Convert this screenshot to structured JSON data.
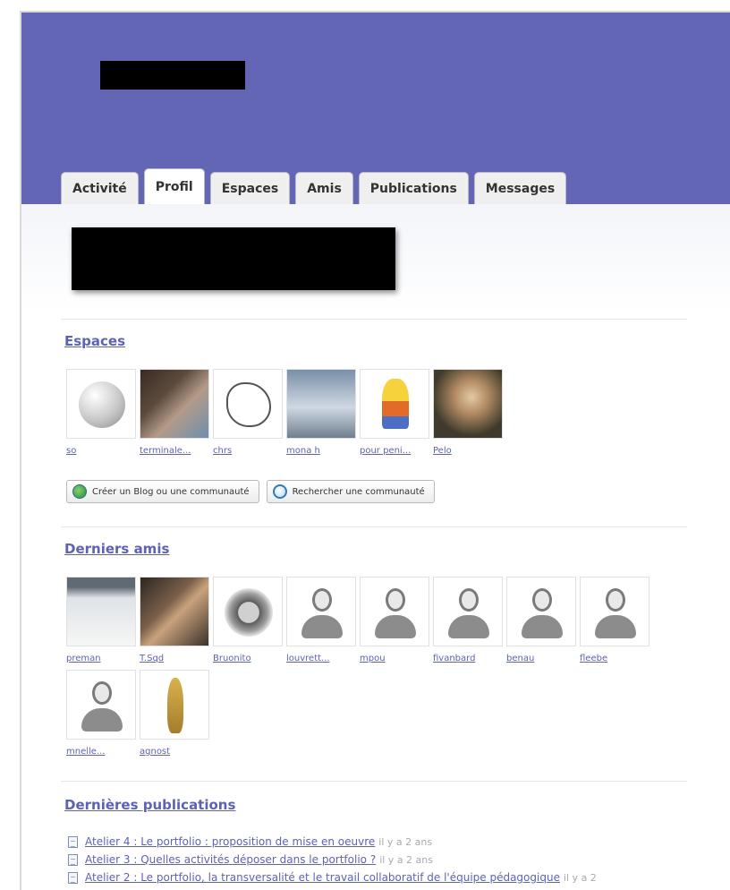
{
  "tabs": [
    "Activité",
    "Profil",
    "Espaces",
    "Amis",
    "Publications",
    "Messages"
  ],
  "active_tab": "Profil",
  "sections": {
    "espaces": {
      "title": "Espaces",
      "items": [
        {
          "label": "so",
          "icon": "globe-icon"
        },
        {
          "label": "terminale...",
          "icon": "photo"
        },
        {
          "label": "chrs",
          "icon": "sketch"
        },
        {
          "label": "mona h",
          "icon": "photo"
        },
        {
          "label": "pour peni...",
          "icon": "cartoon"
        },
        {
          "label": "Pelo",
          "icon": "photo"
        }
      ]
    },
    "buttons": {
      "create": "Créer un Blog ou une communauté",
      "search": "Rechercher une communauté"
    },
    "amis": {
      "title": "Derniers amis",
      "items": [
        {
          "label": "preman",
          "icon": "photo"
        },
        {
          "label": "T.Sqd",
          "icon": "photo"
        },
        {
          "label": "Bruonito",
          "icon": "photo"
        },
        {
          "label": "louvrett...",
          "icon": "default-avatar-icon"
        },
        {
          "label": "mpou",
          "icon": "default-avatar-icon"
        },
        {
          "label": "fivanbard",
          "icon": "default-avatar-icon"
        },
        {
          "label": "benau",
          "icon": "default-avatar-icon"
        },
        {
          "label": "fleebe",
          "icon": "default-avatar-icon"
        },
        {
          "label": "mnelle...",
          "icon": "default-avatar-icon"
        },
        {
          "label": "agnost",
          "icon": "photo"
        }
      ]
    },
    "publications": {
      "title": "Dernières publications",
      "items": [
        {
          "title": "Atelier 4 : Le portfolio : proposition de mise en oeuvre",
          "when": "il y a 2 ans"
        },
        {
          "title": "Atelier 3 : Quelles activités déposer dans le portfolio ?",
          "when": "il y a 2 ans"
        },
        {
          "title": "Atelier 2 : Le portfolio, la transversalité et le travail collaboratif de l'équipe pédagogique",
          "when": "il y a 2"
        }
      ]
    }
  },
  "colors": {
    "banner": "#6366b4",
    "link": "#5d62b8"
  }
}
